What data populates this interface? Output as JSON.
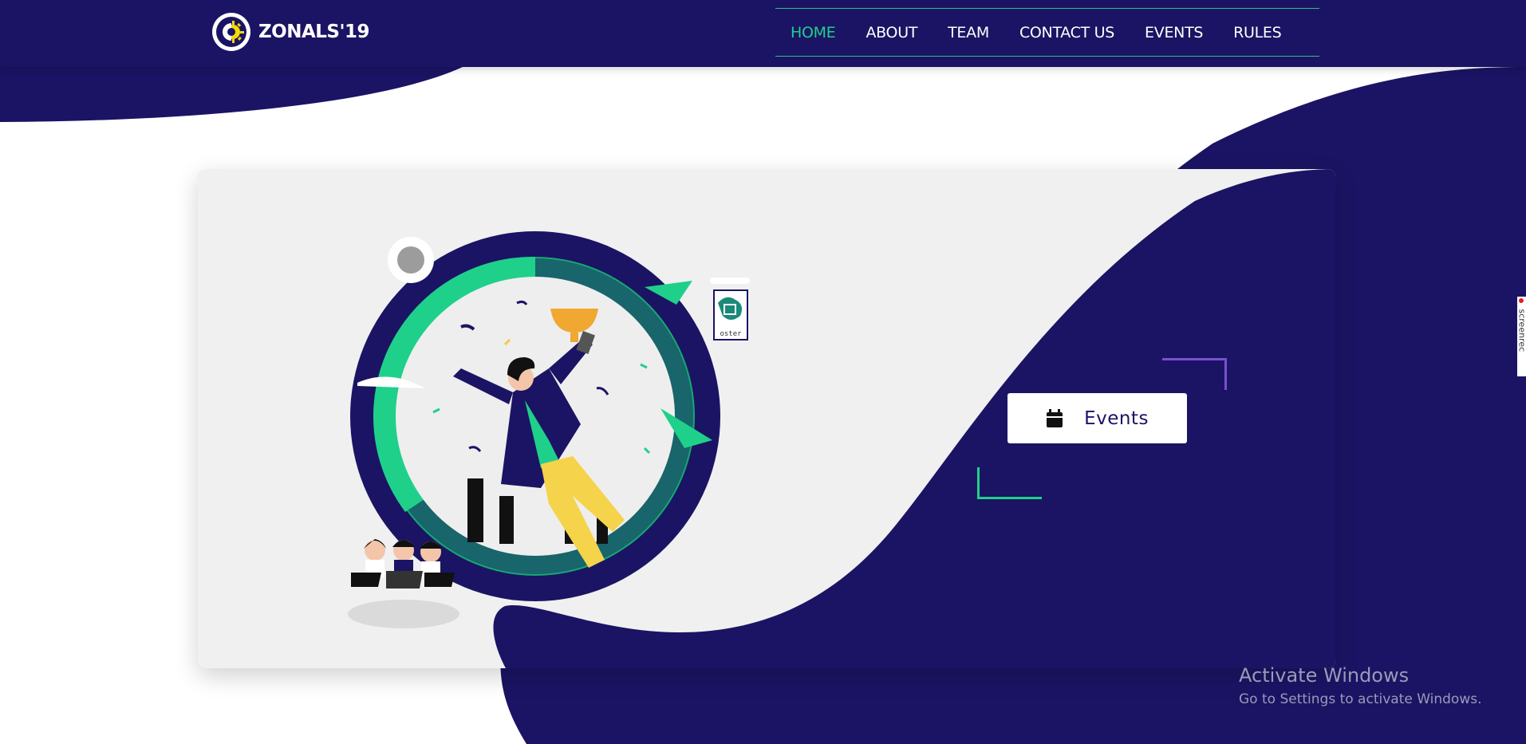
{
  "brand": {
    "name": "ZONALS'19",
    "logo_icon": "sun-gear-logo-icon"
  },
  "nav": {
    "items": [
      {
        "label": "HOME",
        "active": true
      },
      {
        "label": "ABOUT",
        "active": false
      },
      {
        "label": "TEAM",
        "active": false
      },
      {
        "label": "CONTACT US",
        "active": false
      },
      {
        "label": "EVENTS",
        "active": false
      },
      {
        "label": "RULES",
        "active": false
      }
    ]
  },
  "hero": {
    "events_button_label": "Events",
    "events_button_icon": "calendar-icon",
    "poster_label": "oster"
  },
  "windows_watermark": {
    "title": "Activate Windows",
    "subtitle": "Go to Settings to activate Windows."
  },
  "side_widget": {
    "label": "screenrec"
  },
  "colors": {
    "navy": "#1b1464",
    "accent_green": "#1fd08a",
    "accent_purple": "#7a4fd0",
    "card_bg": "#f0f0f0"
  }
}
